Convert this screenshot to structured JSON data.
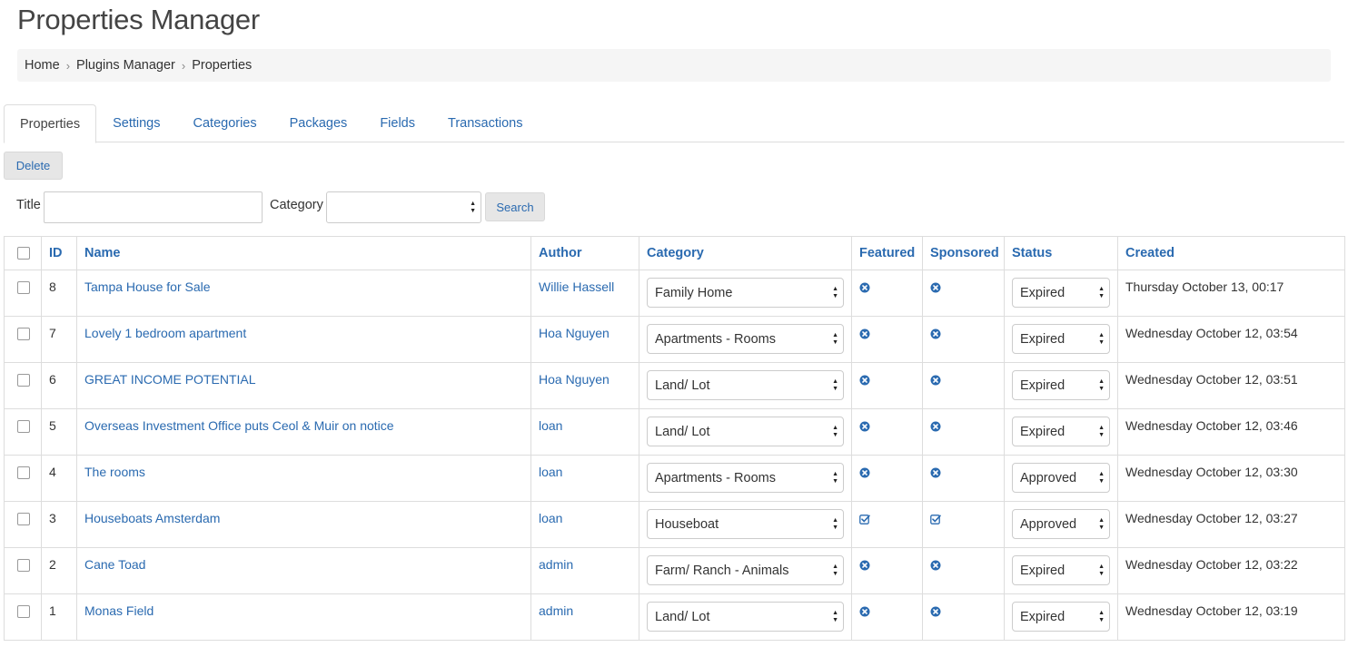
{
  "page": {
    "title": "Properties Manager"
  },
  "breadcrumb": [
    "Home",
    "Plugins Manager",
    "Properties"
  ],
  "tabs": [
    "Properties",
    "Settings",
    "Categories",
    "Packages",
    "Fields",
    "Transactions"
  ],
  "actions": {
    "delete_label": "Delete",
    "search_label": "Search"
  },
  "filters": {
    "title_label": "Title",
    "title_value": "",
    "category_label": "Category",
    "category_value": ""
  },
  "table": {
    "columns": [
      "ID",
      "Name",
      "Author",
      "Category",
      "Featured",
      "Sponsored",
      "Status",
      "Created"
    ],
    "rows": [
      {
        "id": "8",
        "name": "Tampa House for Sale",
        "author": "Willie Hassell",
        "category": "Family Home",
        "featured": false,
        "sponsored": false,
        "status": "Expired",
        "created": "Thursday October 13, 00:17"
      },
      {
        "id": "7",
        "name": "Lovely 1 bedroom apartment",
        "author": "Hoa Nguyen",
        "category": "Apartments - Rooms",
        "featured": false,
        "sponsored": false,
        "status": "Expired",
        "created": "Wednesday October 12, 03:54"
      },
      {
        "id": "6",
        "name": "GREAT INCOME POTENTIAL",
        "author": "Hoa Nguyen",
        "category": "Land/ Lot",
        "featured": false,
        "sponsored": false,
        "status": "Expired",
        "created": "Wednesday October 12, 03:51"
      },
      {
        "id": "5",
        "name": "Overseas Investment Office puts Ceol & Muir on notice",
        "author": "loan",
        "category": "Land/ Lot",
        "featured": false,
        "sponsored": false,
        "status": "Expired",
        "created": "Wednesday October 12, 03:46"
      },
      {
        "id": "4",
        "name": "The rooms",
        "author": "loan",
        "category": "Apartments - Rooms",
        "featured": false,
        "sponsored": false,
        "status": "Approved",
        "created": "Wednesday October 12, 03:30"
      },
      {
        "id": "3",
        "name": "Houseboats Amsterdam",
        "author": "loan",
        "category": "Houseboat",
        "featured": true,
        "sponsored": true,
        "status": "Approved",
        "created": "Wednesday October 12, 03:27"
      },
      {
        "id": "2",
        "name": "Cane Toad",
        "author": "admin",
        "category": "Farm/ Ranch - Animals",
        "featured": false,
        "sponsored": false,
        "status": "Expired",
        "created": "Wednesday October 12, 03:22"
      },
      {
        "id": "1",
        "name": "Monas Field",
        "author": "admin",
        "category": "Land/ Lot",
        "featured": false,
        "sponsored": false,
        "status": "Expired",
        "created": "Wednesday October 12, 03:19"
      }
    ]
  },
  "icons": {
    "no": "circle-x-icon",
    "yes": "check-square-icon"
  },
  "colors": {
    "link": "#2a6ab0",
    "breadcrumb_bg": "#f5f5f5",
    "button_bg": "#e6e6e6"
  }
}
